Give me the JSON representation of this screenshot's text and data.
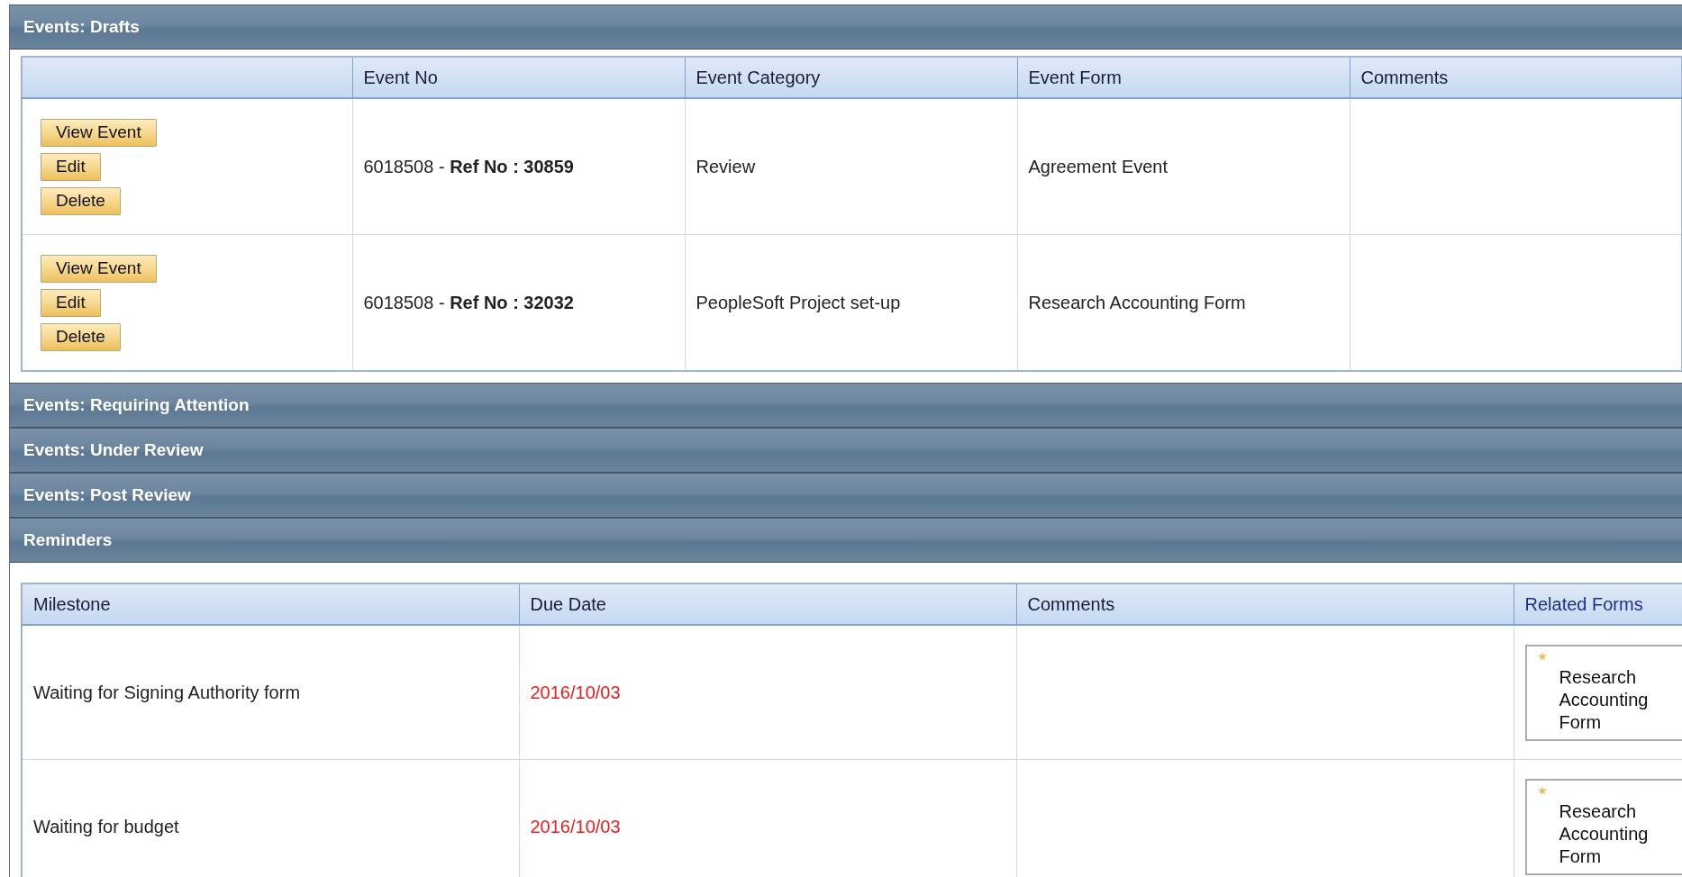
{
  "sections": [
    {
      "title": "Events: Drafts",
      "kind": "events",
      "columns": [
        "Event No",
        "Event Category",
        "Event Form",
        "Comments"
      ],
      "rows": [
        {
          "actions": [
            "View Event",
            "Edit",
            "Delete"
          ],
          "event_no": "6018508 - **Ref No : 30859**",
          "category": "Review",
          "form": "Agreement Event"
        },
        {
          "actions": [
            "View Event",
            "Edit",
            "Delete"
          ],
          "event_no": "6018508 - **Ref No : 32032**",
          "category": "PeopleSoft Project set-up",
          "form": "Research Accounting Form"
        }
      ]
    },
    {
      "title": "Events: Requiring Attention",
      "kind": "events"
    },
    {
      "title": "Events: Under Review",
      "kind": "events"
    },
    {
      "title": "Events: Post Review",
      "kind": "events"
    },
    {
      "title": "Reminders",
      "kind": "reminders",
      "columns": [
        "Milestone",
        "Due Date",
        "Comments",
        "Related Forms"
      ],
      "rows": [
        {
          "milestone": "Waiting for Signing Authority form",
          "due_date": "2016/10/03",
          "overdue": true,
          "related_forms": [
            "Research Accounting Form"
          ]
        },
        {
          "milestone": "Waiting for budget",
          "due_date": "2016/10/03",
          "overdue": true,
          "related_forms": [
            "Research Accounting Form"
          ]
        }
      ]
    }
  ]
}
